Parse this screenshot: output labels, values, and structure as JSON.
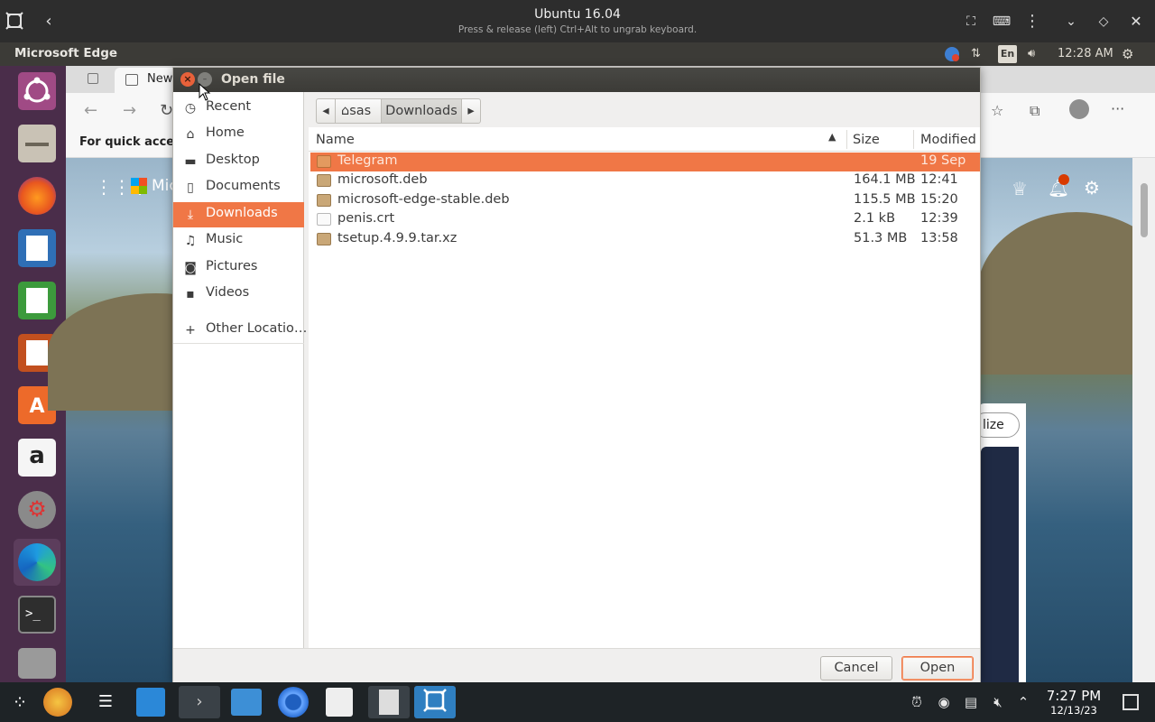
{
  "vm": {
    "title": "Ubuntu 16.04",
    "subtitle": "Press & release (left) Ctrl+Alt to ungrab keyboard."
  },
  "panel": {
    "app_name": "Microsoft Edge",
    "keyboard_layout": "En",
    "time": "12:28 AM"
  },
  "browser": {
    "tab_label": "New",
    "favorites_text": "For quick access",
    "brand_text": "Mic",
    "personalize_text": "lize"
  },
  "dialog": {
    "title": "Open file",
    "sidebar": [
      {
        "label": "Recent",
        "icon": "clock-icon"
      },
      {
        "label": "Home",
        "icon": "home-icon"
      },
      {
        "label": "Desktop",
        "icon": "folder-icon"
      },
      {
        "label": "Documents",
        "icon": "document-icon"
      },
      {
        "label": "Downloads",
        "icon": "download-icon",
        "active": true
      },
      {
        "label": "Music",
        "icon": "music-icon"
      },
      {
        "label": "Pictures",
        "icon": "camera-icon"
      },
      {
        "label": "Videos",
        "icon": "video-icon"
      },
      {
        "label": "Other Locatio…",
        "icon": "plus-icon"
      }
    ],
    "path": {
      "home": "sas",
      "current": "Downloads"
    },
    "columns": {
      "name": "Name",
      "size": "Size",
      "modified": "Modified"
    },
    "files": [
      {
        "name": "Telegram",
        "size": "",
        "modified": "19 Sep",
        "type": "folder",
        "selected": true
      },
      {
        "name": "microsoft.deb",
        "size": "164.1 MB",
        "modified": "12:41",
        "type": "package"
      },
      {
        "name": "microsoft-edge-stable.deb",
        "size": "115.5 MB",
        "modified": "15:20",
        "type": "package"
      },
      {
        "name": "penis.crt",
        "size": "2.1 kB",
        "modified": "12:39",
        "type": "document"
      },
      {
        "name": "tsetup.4.9.9.tar.xz",
        "size": "51.3 MB",
        "modified": "13:58",
        "type": "package"
      }
    ],
    "buttons": {
      "cancel": "Cancel",
      "open": "Open"
    }
  },
  "taskbar": {
    "time": "7:27 PM",
    "date": "12/13/23"
  },
  "colors": {
    "ubuntu_orange": "#f07746",
    "panel": "#3c3b37",
    "launcher": "#4a2d4a"
  }
}
